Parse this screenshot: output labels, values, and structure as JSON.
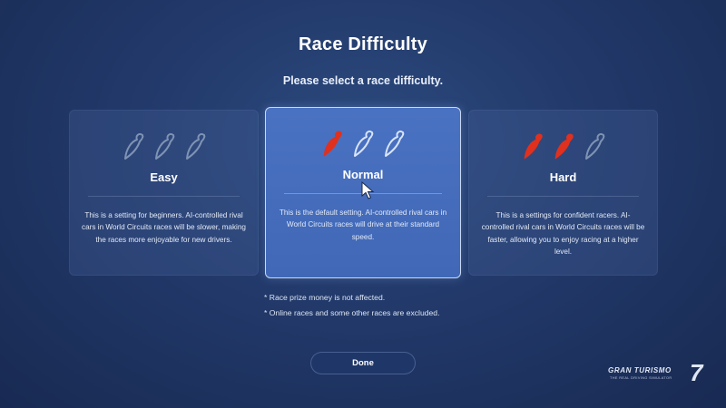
{
  "header": {
    "title": "Race Difficulty",
    "subtitle": "Please select a race difficulty."
  },
  "options": [
    {
      "label": "Easy",
      "description": "This is a setting for beginners. AI-controlled rival cars in World Circuits races will be slower, making the races more enjoyable for new drivers.",
      "peppers_lit": 0,
      "peppers_total": 3,
      "selected": false
    },
    {
      "label": "Normal",
      "description": "This is the default setting. AI-controlled rival cars in World Circuits races will drive at their standard speed.",
      "peppers_lit": 1,
      "peppers_total": 3,
      "selected": true
    },
    {
      "label": "Hard",
      "description": "This is a settings for confident racers. AI-controlled rival cars in World Circuits races will be faster, allowing you to enjoy racing at a higher level.",
      "peppers_lit": 2,
      "peppers_total": 3,
      "selected": false
    }
  ],
  "notes": [
    "* Race prize money is not affected.",
    "* Online races and some other races are excluded."
  ],
  "buttons": {
    "done": "Done"
  },
  "logo": {
    "name": "GRAN TURISMO",
    "number": "7",
    "tagline": "THE REAL DRIVING SIMULATOR"
  },
  "icons": {
    "difficulty": "chili-pepper-icon",
    "pointer": "mouse-cursor-icon"
  },
  "colors": {
    "pepper_lit": "#e0301e",
    "pepper_unlit_easy": "#7f93b4",
    "pepper_unlit_selected": "#d8e4f8",
    "selected_card": "#4a72c2",
    "background": "#22396a"
  }
}
